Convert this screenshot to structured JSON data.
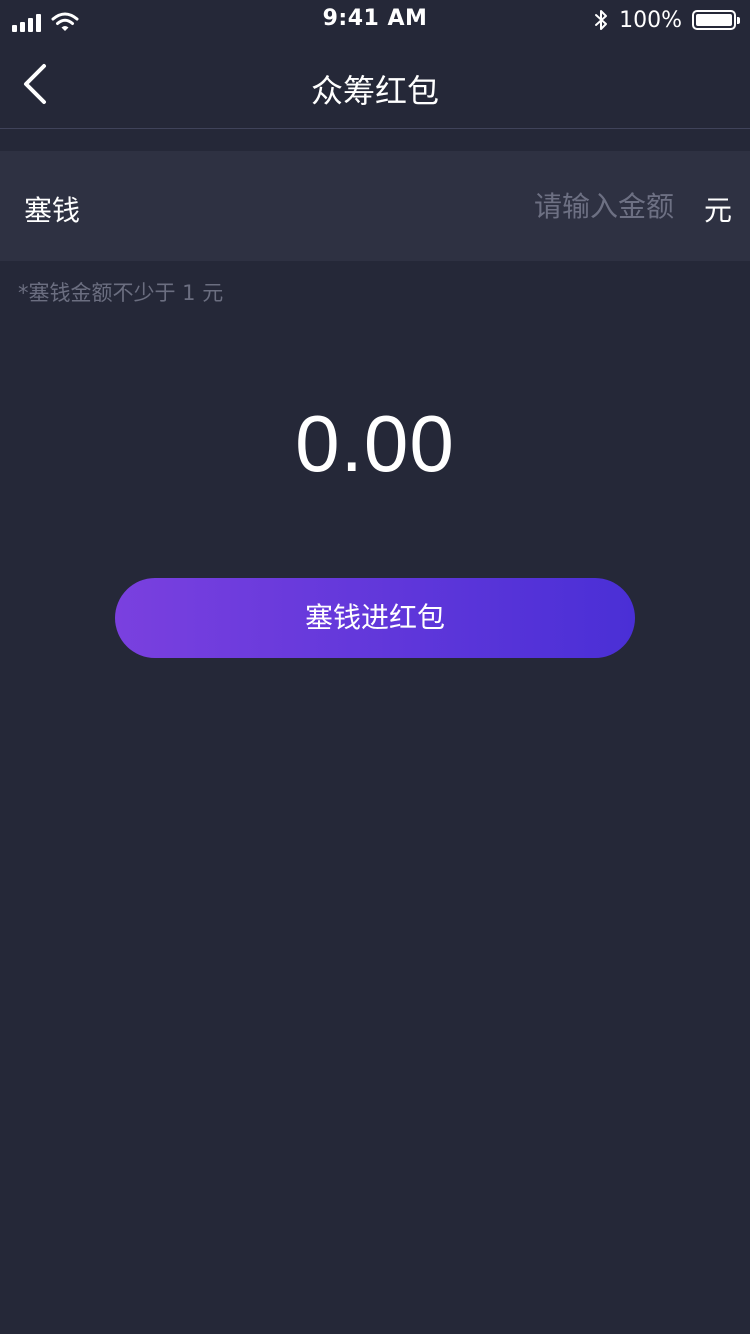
{
  "status_bar": {
    "time": "9:41 AM",
    "battery_percent": "100%",
    "signal_bars": 4,
    "battery_level": 1.0,
    "icons": [
      "signal-icon",
      "wifi-icon",
      "bluetooth-icon",
      "battery-icon"
    ]
  },
  "nav": {
    "title": "众筹红包",
    "back_icon": "chevron-left-icon"
  },
  "amount_form": {
    "label": "塞钱",
    "placeholder": "请输入金额",
    "value": "",
    "unit": "元",
    "hint": "*塞钱金额不少于 1 元"
  },
  "total": {
    "amount": "0.00"
  },
  "submit": {
    "label": "塞钱进红包"
  },
  "colors": {
    "background": "#252838",
    "row_background": "#2e3142",
    "placeholder": "#6d7083",
    "hint": "#6b6e80",
    "button_gradient_start": "#7a40df",
    "button_gradient_end": "#4a2fd6"
  }
}
